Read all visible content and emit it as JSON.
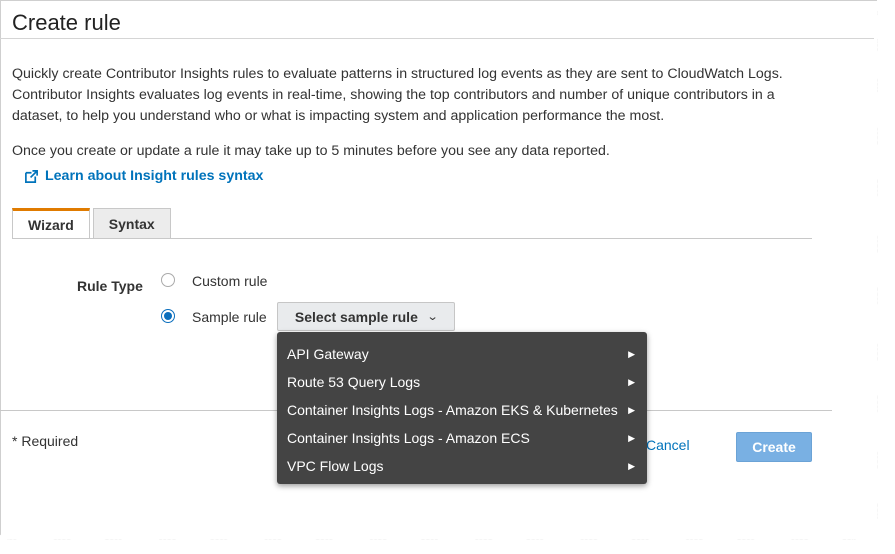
{
  "header": {
    "title": "Create rule"
  },
  "intro": {
    "description": "Quickly create Contributor Insights rules to evaluate patterns in structured log events as they are sent to CloudWatch Logs. Contributor Insights evaluates log events in real-time, showing the top contributors and number of unique contributors in a dataset, to help you understand who or what is impacting system and application performance the most.",
    "note": "Once you create or update a rule it may take up to 5 minutes before you see any data reported.",
    "learn_link": "Learn about Insight rules syntax"
  },
  "tabs": [
    {
      "label": "Wizard",
      "active": true
    },
    {
      "label": "Syntax",
      "active": false
    }
  ],
  "rule_type": {
    "label": "Rule Type",
    "options": [
      {
        "label": "Custom rule",
        "selected": false
      },
      {
        "label": "Sample rule",
        "selected": true
      }
    ],
    "select_button": "Select sample rule"
  },
  "menu": {
    "items": [
      {
        "label": "API Gateway"
      },
      {
        "label": "Route 53 Query Logs"
      },
      {
        "label": "Container Insights Logs - Amazon EKS & Kubernetes"
      },
      {
        "label": "Container Insights Logs - Amazon ECS"
      },
      {
        "label": "VPC Flow Logs"
      }
    ]
  },
  "footer": {
    "required": "* Required",
    "cancel": "Cancel",
    "create": "Create"
  },
  "colors": {
    "link": "#0073bb",
    "tab_accent": "#e07b00",
    "create_button": "#79b0e3",
    "menu_background": "#444444"
  },
  "icons": {
    "external_link": "external-link-icon",
    "chevron": "chevron-down-icon",
    "submenu_arrow": "caret-right-icon"
  }
}
